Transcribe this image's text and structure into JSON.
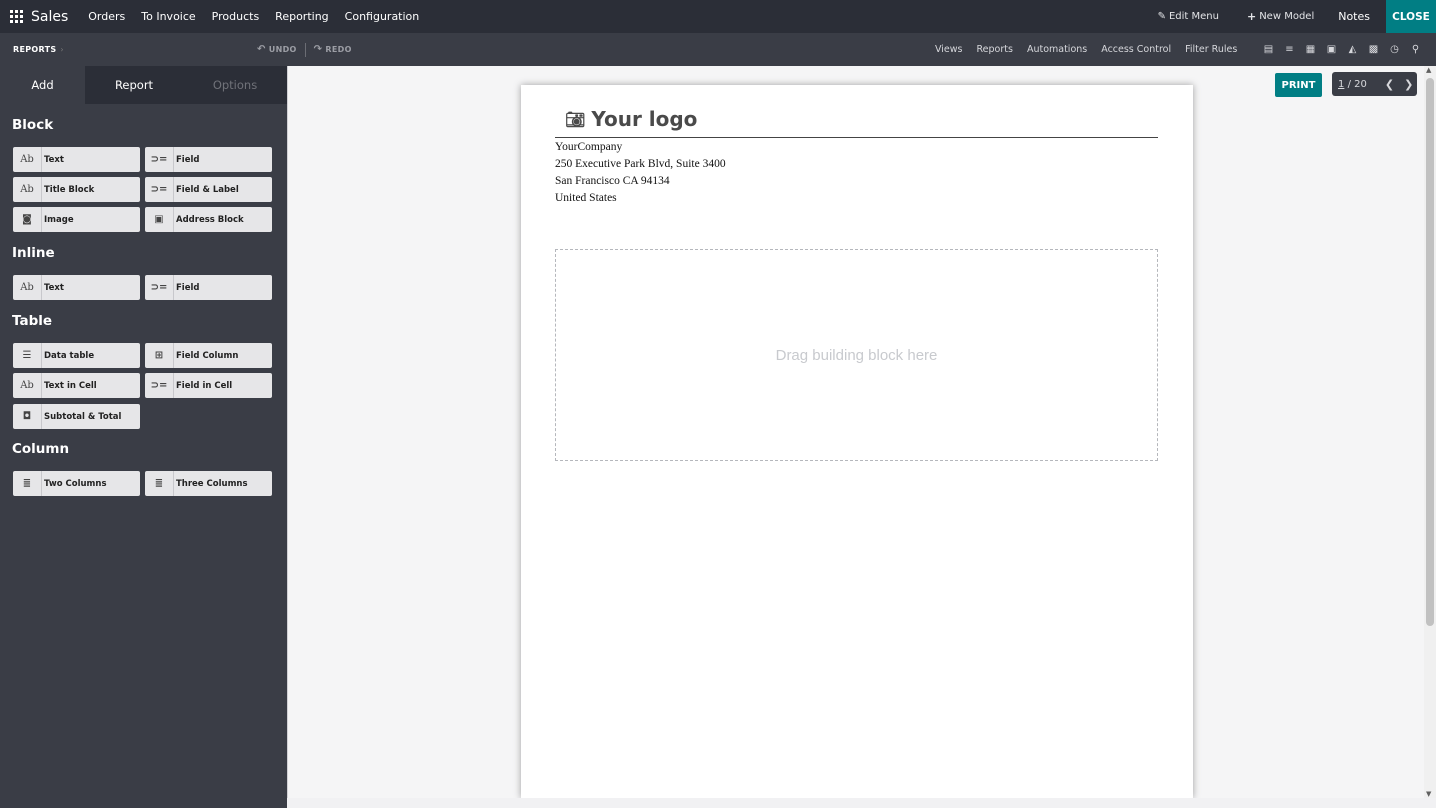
{
  "navbar": {
    "app_name": "Sales",
    "menu": [
      "Orders",
      "To Invoice",
      "Products",
      "Reporting",
      "Configuration"
    ],
    "edit_menu": "Edit Menu",
    "new_model": "New Model",
    "notes": "Notes",
    "close": "CLOSE"
  },
  "subbar": {
    "breadcrumb": "REPORTS",
    "undo": "UNDO",
    "redo": "REDO",
    "links": [
      "Views",
      "Reports",
      "Automations",
      "Access Control",
      "Filter Rules"
    ]
  },
  "sidebar": {
    "tabs": [
      "Add",
      "Report",
      "Options"
    ],
    "sections": {
      "block": "Block",
      "inline": "Inline",
      "table": "Table",
      "column": "Column"
    },
    "block_items": [
      "Text",
      "Field",
      "Title Block",
      "Field & Label",
      "Image",
      "Address Block"
    ],
    "inline_items": [
      "Text",
      "Field"
    ],
    "table_items": [
      "Data table",
      "Field Column",
      "Text in Cell",
      "Field in Cell",
      "Subtotal & Total"
    ],
    "column_items": [
      "Two Columns",
      "Three Columns"
    ]
  },
  "report": {
    "logo": "Your logo",
    "address": [
      "YourCompany",
      "250 Executive Park Blvd, Suite 3400",
      "San Francisco CA 94134",
      "United States"
    ],
    "dropzone": "Drag building block here"
  },
  "toolbar": {
    "print": "PRINT",
    "page_current": "1",
    "page_total": "/ 20"
  },
  "colors": {
    "accent": "#017e84",
    "navbar": "#2b2e37",
    "sidebar": "#3a3d46"
  }
}
